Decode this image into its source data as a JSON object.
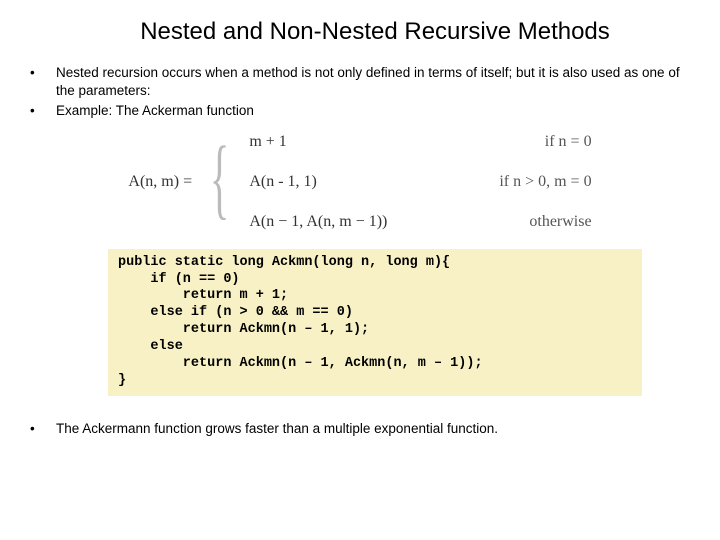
{
  "title": "Nested and Non-Nested Recursive Methods",
  "bullets": {
    "b1": "Nested recursion occurs when a method is not only defined in terms of itself; but it is also used as one of the parameters:",
    "b2": "Example: The Ackerman function"
  },
  "formula": {
    "lhs": "A(n, m) =",
    "case1_expr": "m + 1",
    "case1_cond": "if n = 0",
    "case2_expr": "A(n - 1, 1)",
    "case2_cond": "if n > 0, m = 0",
    "case3_expr": "A(n − 1, A(n, m − 1))",
    "case3_cond": "otherwise"
  },
  "code": "public static long Ackmn(long n, long m){\n    if (n == 0)\n        return m + 1;\n    else if (n > 0 && m == 0)\n        return Ackmn(n – 1, 1);\n    else\n        return Ackmn(n – 1, Ackmn(n, m – 1));\n}",
  "after": "The Ackermann function grows faster than a multiple exponential function."
}
